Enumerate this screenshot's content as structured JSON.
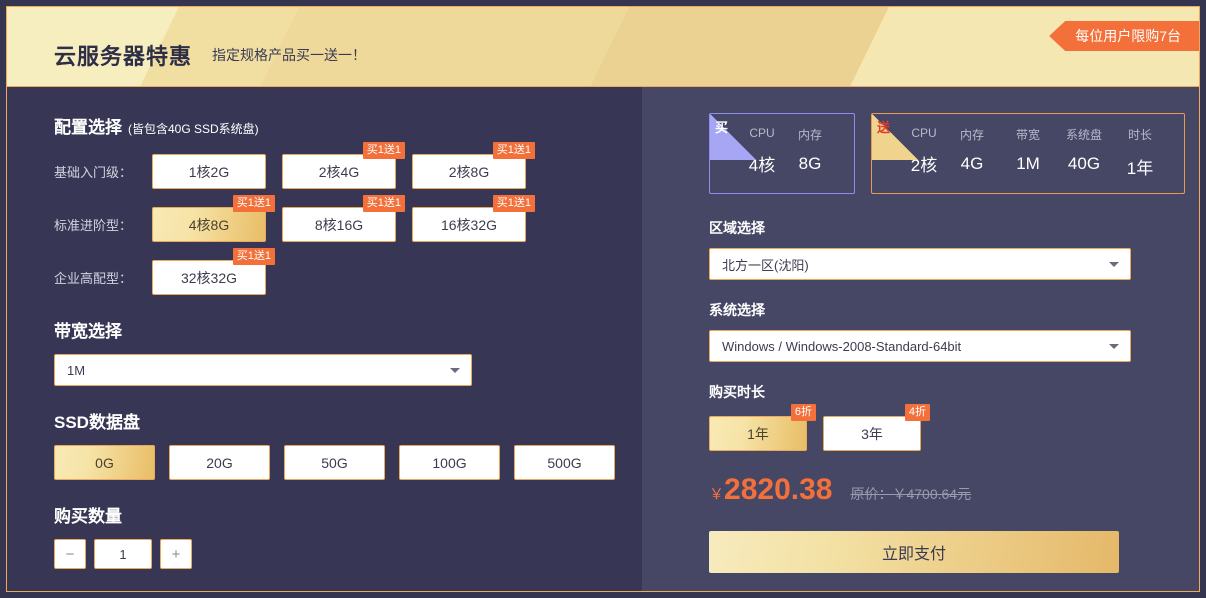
{
  "header": {
    "title": "云服务器特惠",
    "subtitle": "指定规格产品买一送一！",
    "ribbon": "每位用户限购7台"
  },
  "left": {
    "config": {
      "title": "配置选择",
      "note": "(皆包含40G SSD系统盘)",
      "rows": [
        {
          "label": "基础入门级：",
          "options": [
            {
              "label": "1核2G",
              "badge": "",
              "selected": false
            },
            {
              "label": "2核4G",
              "badge": "买1送1",
              "selected": false
            },
            {
              "label": "2核8G",
              "badge": "买1送1",
              "selected": false
            }
          ]
        },
        {
          "label": "标准进阶型：",
          "options": [
            {
              "label": "4核8G",
              "badge": "买1送1",
              "selected": true
            },
            {
              "label": "8核16G",
              "badge": "买1送1",
              "selected": false
            },
            {
              "label": "16核32G",
              "badge": "买1送1",
              "selected": false
            }
          ]
        },
        {
          "label": "企业高配型：",
          "options": [
            {
              "label": "32核32G",
              "badge": "买1送1",
              "selected": false
            }
          ]
        }
      ]
    },
    "bandwidth": {
      "title": "带宽选择",
      "value": "1M",
      "caret": "chevron-down-icon"
    },
    "ssd": {
      "title": "SSD数据盘",
      "options": [
        {
          "label": "0G",
          "selected": true
        },
        {
          "label": "20G",
          "selected": false
        },
        {
          "label": "50G",
          "selected": false
        },
        {
          "label": "100G",
          "selected": false
        },
        {
          "label": "500G",
          "selected": false
        }
      ]
    },
    "quantity": {
      "title": "购买数量",
      "minus": "−",
      "value": "1",
      "plus": "+"
    }
  },
  "right": {
    "spec_buy": {
      "corner": "买",
      "columns": [
        {
          "key": "CPU",
          "value": "4核"
        },
        {
          "key": "内存",
          "value": "8G"
        }
      ]
    },
    "spec_gift": {
      "corner": "送",
      "columns": [
        {
          "key": "CPU",
          "value": "2核"
        },
        {
          "key": "内存",
          "value": "4G"
        },
        {
          "key": "带宽",
          "value": "1M"
        },
        {
          "key": "系统盘",
          "value": "40G"
        },
        {
          "key": "时长",
          "value": "1年"
        }
      ]
    },
    "region": {
      "title": "区域选择",
      "value": "北方一区(沈阳)"
    },
    "system": {
      "title": "系统选择",
      "value": "Windows / Windows-2008-Standard-64bit"
    },
    "duration": {
      "title": "购买时长",
      "options": [
        {
          "label": "1年",
          "badge": "6折",
          "selected": true
        },
        {
          "label": "3年",
          "badge": "4折",
          "selected": false
        }
      ]
    },
    "price": {
      "currency": "￥",
      "amount": "2820.38",
      "original": "原价：￥4700.64元"
    },
    "pay_label": "立即支付"
  },
  "colors": {
    "accent_orange": "#f4703b",
    "gold": "#e8bd66",
    "panel_left": "#373755",
    "panel_right": "#464665",
    "border_gold": "#eaa95a"
  }
}
